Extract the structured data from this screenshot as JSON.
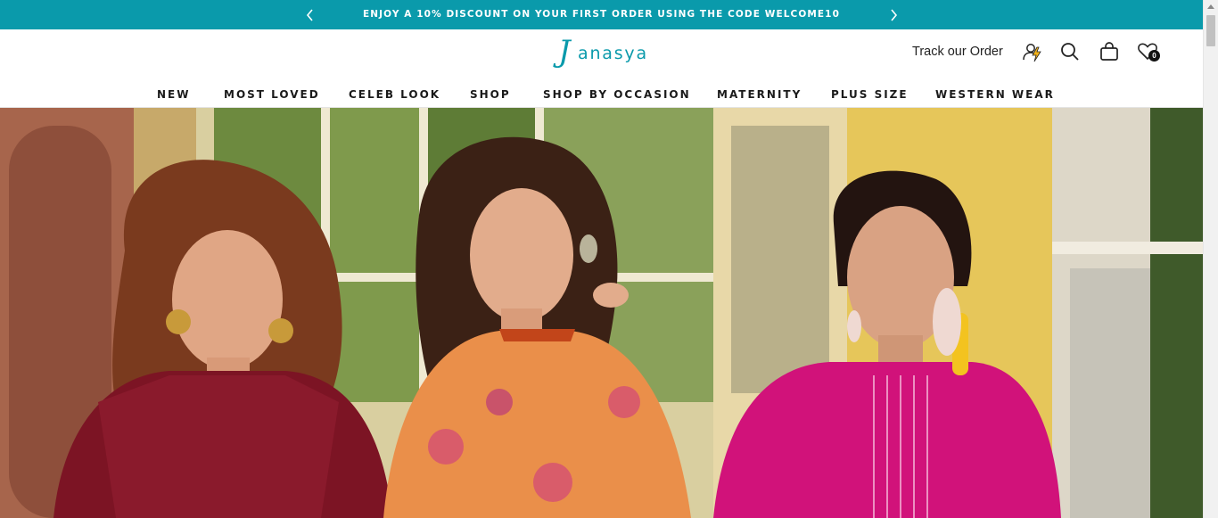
{
  "announcement": {
    "text": "ENJOY A 10% DISCOUNT ON YOUR FIRST ORDER USING THE CODE WELCOME10",
    "prev_icon": "chevron-left-icon",
    "next_icon": "chevron-right-icon",
    "background": "#0a9aab"
  },
  "header": {
    "logo_initial": "J",
    "logo_rest": "anasya",
    "track_order_label": "Track our Order",
    "icons": [
      "lightning-user-icon",
      "search-icon",
      "shopping-bag-icon",
      "heart-icon"
    ],
    "wishlist_count": "0",
    "brand_color": "#0a9aab"
  },
  "nav": {
    "items": [
      "NEW",
      "MOST LOVED",
      "CELEB LOOK",
      "SHOP",
      "SHOP BY OCCASION",
      "MATERNITY",
      "PLUS SIZE",
      "WESTERN WEAR"
    ]
  },
  "hero": {
    "image": "three-women-in-ethnic-wear-hero-banner"
  }
}
